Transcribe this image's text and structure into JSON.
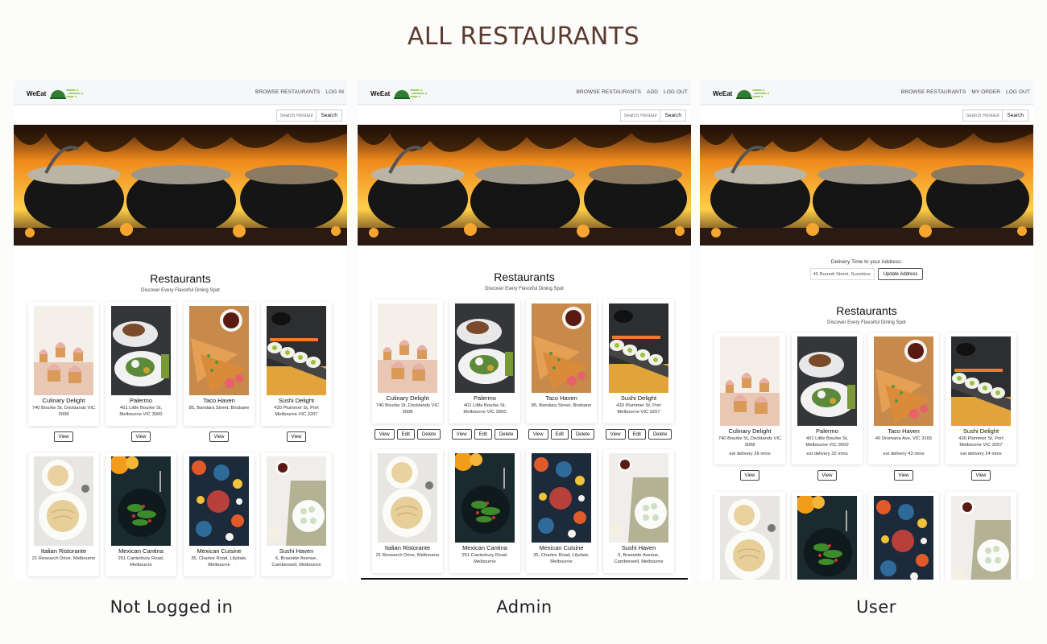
{
  "page": {
    "title": "ALL RESTAURANTS"
  },
  "app": {
    "logo_text": "WeEat"
  },
  "search": {
    "placeholder": "Search Restaurants",
    "button": "Search"
  },
  "section": {
    "title": "Restaurants",
    "subtitle": "Discover Every Flavorful Dining Spot"
  },
  "delivery": {
    "label": "Delivery Time to your Address:",
    "address": "45 Burnett Street, Sunshine",
    "update_button": "Update Address"
  },
  "actions": {
    "view": "View",
    "edit": "Edit",
    "delete": "Delete"
  },
  "panels": [
    {
      "caption": "Not Logged in",
      "nav": [
        "BROWSE RESTAURANTS",
        "LOG IN"
      ]
    },
    {
      "caption": "Admin",
      "nav": [
        "BROWSE RESTAURANTS",
        "ADD",
        "LOG OUT"
      ]
    },
    {
      "caption": "User",
      "nav": [
        "BROWSE RESTAURANTS",
        "MY ORDER",
        "LOG OUT"
      ]
    }
  ],
  "restaurants": [
    {
      "name": "Culinary Delight",
      "address": "740 Bourke St, Docklands VIC 3008",
      "est": "est delivery 26 mins",
      "image": "cupcakes"
    },
    {
      "name": "Palermo",
      "address": "401 Little Bourke St, Melbourne VIC 3000",
      "est": "est delivery 32 mins",
      "image": "plated-dish"
    },
    {
      "name": "Taco Haven",
      "address": "85, Bandara Street, Brisbane",
      "user_address": "40 Dromana Ave, VIC 3165",
      "est": "est delivery 43 mins",
      "image": "quesadilla"
    },
    {
      "name": "Sushi Delight",
      "address": "430 Plummer St, Port Melbourne VIC 3207",
      "est": "est delivery 24 mins",
      "image": "sushi-roll"
    },
    {
      "name": "Italian Ristorante",
      "address": "21 Research Drive, Melbourne",
      "image": "pasta"
    },
    {
      "name": "Mexican Cantina",
      "address": "251 Canterbury Road, Melbourne",
      "image": "salad"
    },
    {
      "name": "Mexican Cuisine",
      "address": "35, Charles Road, Lilydale, Melbourne",
      "image": "table-spread"
    },
    {
      "name": "Sushi Haven",
      "address": "6, Braeside Avenue, Camberwell, Melbourne",
      "image": "sushi-plate"
    }
  ],
  "colors": {
    "title": "#5a3b2e",
    "flame": "#f08a1c",
    "logo_green": "#2e7d32"
  }
}
